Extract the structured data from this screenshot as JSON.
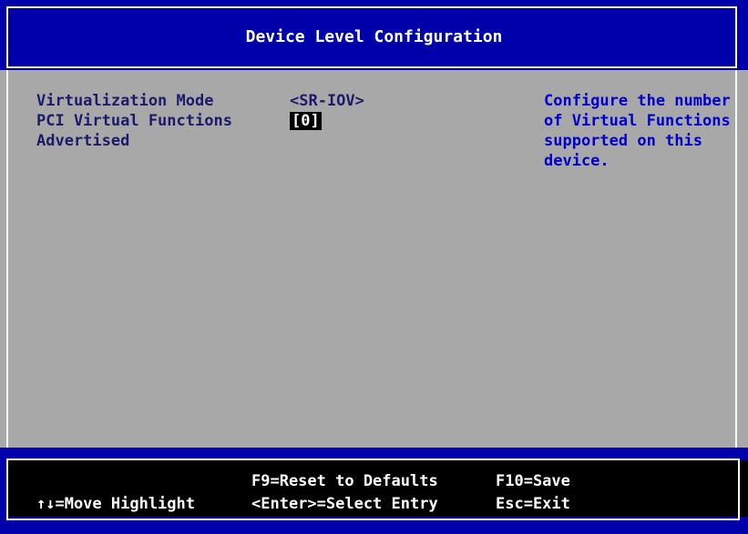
{
  "header": {
    "title": "Device Level Configuration"
  },
  "settings": [
    {
      "label": "Virtualization Mode",
      "value": "<SR-IOV>"
    },
    {
      "label": "PCI Virtual Functions",
      "label_line2": "Advertised",
      "value": "[0]"
    }
  ],
  "help": {
    "lines": [
      "Configure the number",
      "of Virtual Functions",
      "supported on this",
      "device."
    ]
  },
  "footer": {
    "move_highlight": "↑↓=Move Highlight",
    "reset_defaults": "F9=Reset to Defaults",
    "select_entry": "<Enter>=Select Entry",
    "save": "F10=Save",
    "exit": "Esc=Exit"
  },
  "colors": {
    "background": "#a8a8a8",
    "header_bg": "#0000aa",
    "label_text": "#1b1b6a",
    "help_text": "#0000cc",
    "highlight_bg": "#000000"
  }
}
